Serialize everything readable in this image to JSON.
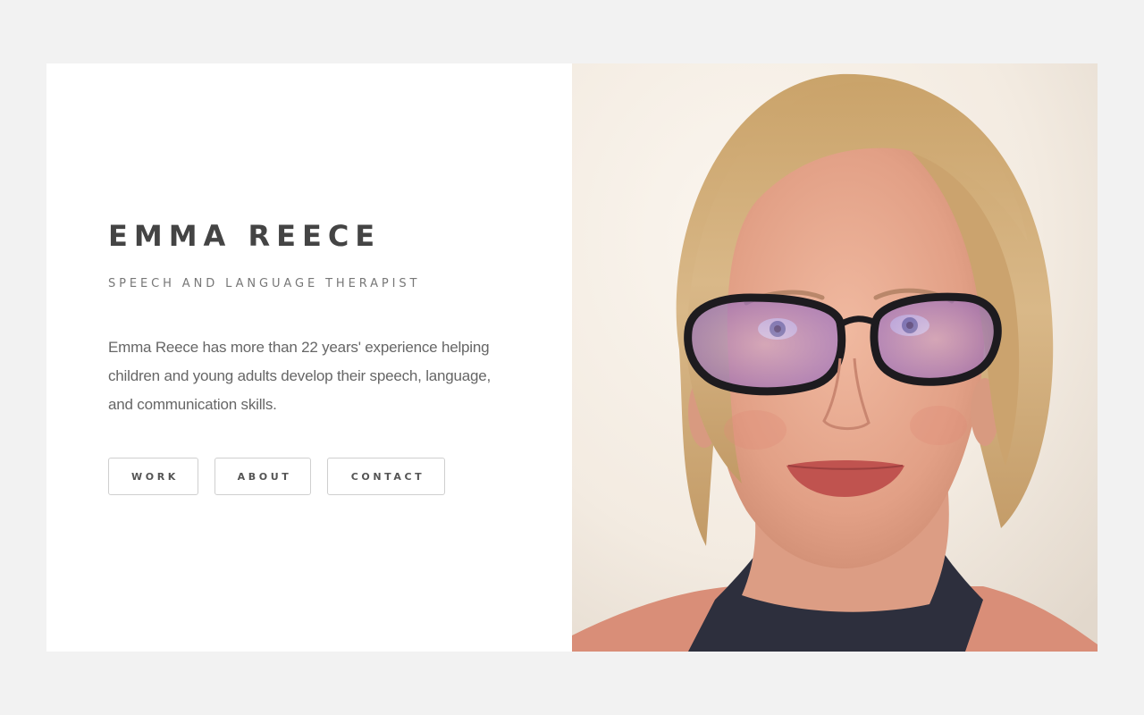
{
  "profile": {
    "name": "EMMA REECE",
    "title": "SPEECH AND LANGUAGE THERAPIST",
    "bio": "Emma Reece has more than 22 years' experience helping children and young adults develop their speech, language, and communication skills."
  },
  "nav": {
    "buttons": [
      {
        "label": "WORK"
      },
      {
        "label": "ABOUT"
      },
      {
        "label": "CONTACT"
      }
    ]
  },
  "photo": {
    "subject": "portrait of woman with blonde hair and dark-framed glasses"
  },
  "colors": {
    "background": "#f2f2f2",
    "panel": "#ffffff",
    "heading": "#444444",
    "subtitle": "#777777",
    "body_text": "#666666",
    "button_border": "#cfcfcf"
  }
}
